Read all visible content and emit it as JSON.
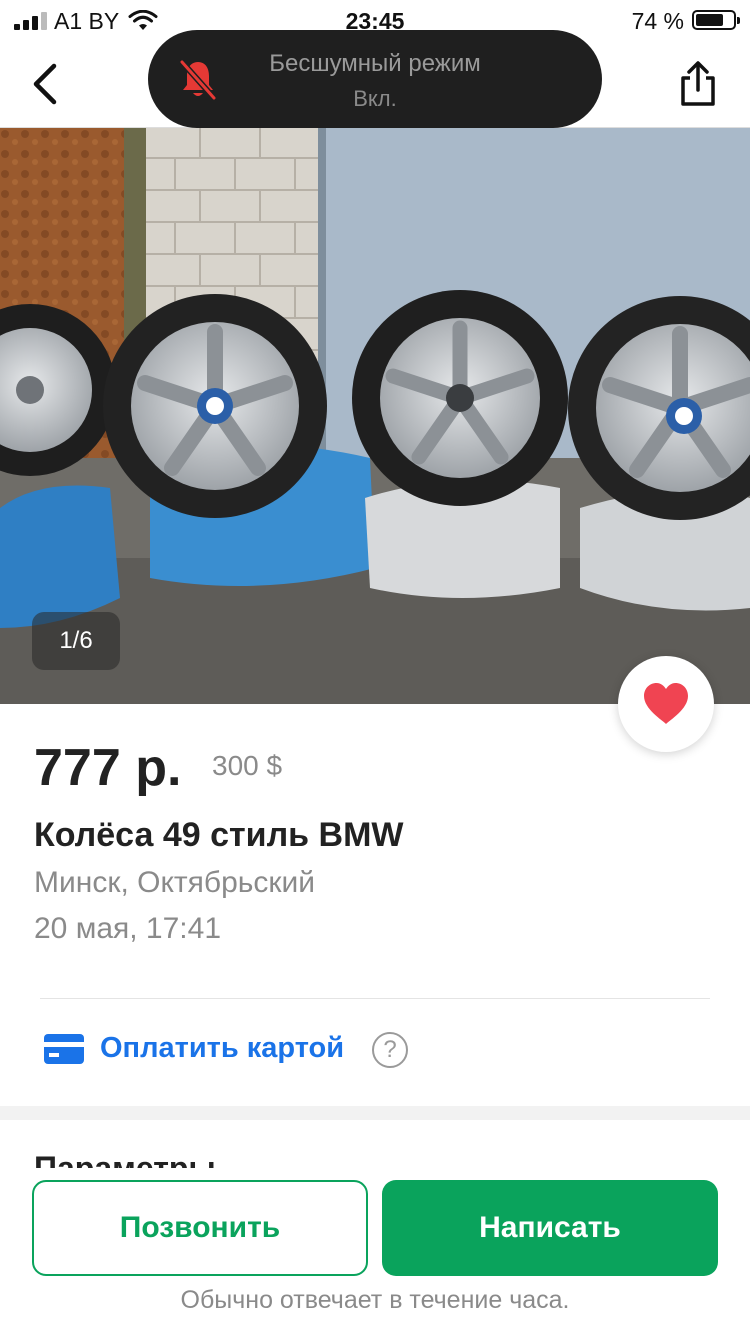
{
  "status_bar": {
    "carrier": "A1 BY",
    "time": "23:45",
    "battery": "74 %",
    "battery_level": 0.74
  },
  "toast": {
    "title": "Бесшумный режим",
    "subtitle": "Вкл.",
    "icon": "bell-slash-icon",
    "icon_color": "#e53935"
  },
  "nav": {
    "back_icon": "chevron-left-icon",
    "share_icon": "share-icon"
  },
  "gallery": {
    "counter": "1/6",
    "favorite_icon": "heart-icon",
    "favorite_color": "#f04452"
  },
  "listing": {
    "price": "777 р.",
    "price_alt": "300 $",
    "title": "Колёса 49 стиль BMW",
    "location": "Минск, Октябрьский",
    "date": "20 мая, 17:41"
  },
  "payment": {
    "label": "Оплатить картой",
    "help": "?",
    "icon": "credit-card-icon",
    "color": "#1a73e8"
  },
  "params": {
    "heading": "Параметры"
  },
  "actions": {
    "call": "Позвонить",
    "write": "Написать",
    "note": "Обычно отвечает в течение часа.",
    "accent": "#0aa35c"
  }
}
